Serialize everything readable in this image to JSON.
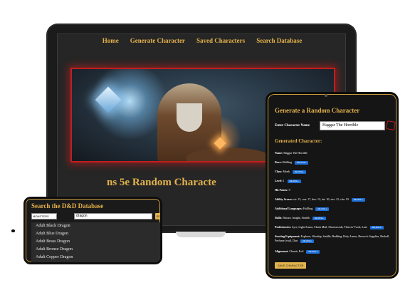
{
  "laptop": {
    "nav": [
      "Home",
      "Generate Character",
      "Saved Characters",
      "Search Database"
    ],
    "title_fragment": "ns 5e Random Characte"
  },
  "phone": {
    "title": "Search the D&D Database",
    "select_value": "MONSTERS",
    "search_value": "dragon",
    "search_button": "SEARCH",
    "results": [
      "Adult Black Dragon",
      "Adult Blue Dragon",
      "Adult Brass Dragon",
      "Adult Bronze Dragon",
      "Adult Copper Dragon"
    ]
  },
  "tablet": {
    "title": "Generate a Random Character",
    "name_label": "Enter Character Name",
    "name_value": "Haggar The Horrible",
    "generated_title": "Generated Character:",
    "roll_label": "RE-ROLL",
    "save_label": "SAVE CHARACTER",
    "attributes": [
      {
        "label": "Name:",
        "value": "Haggar The Horrible"
      },
      {
        "label": "Race:",
        "value": "Halfling"
      },
      {
        "label": "Class:",
        "value": "Monk"
      },
      {
        "label": "Level:",
        "value": "1"
      },
      {
        "label": "Hit Points:",
        "value": "9"
      },
      {
        "label": "Ability Scores:",
        "value": "str: 15, con: 17, dex: 12, int: 10, wis: 12, cha: 10"
      },
      {
        "label": "Additional Languages:",
        "value": "Halfling"
      },
      {
        "label": "Skills:",
        "value": "Nature, Insight, Stealth"
      },
      {
        "label": "Proficiencies:",
        "value": "Lyre, Light Armor, Chain Mail, Shortswords, Thieves' Tools, Lute"
      },
      {
        "label": "Starting Equipment:",
        "value": "Explorer, Worship, Saddle, Bedding, Holy Armor, Brewer's Supplies, Bedroll, Perfume (vial), Dart"
      },
      {
        "label": "Alignment:",
        "value": "Chaotic Evil"
      }
    ]
  },
  "colors": {
    "accent": "#e3b24c",
    "button_blue": "#1f6fd6",
    "frame": "#1b1b1b",
    "hero_border": "#c21e1e"
  },
  "icons": [
    "dice-icon"
  ]
}
